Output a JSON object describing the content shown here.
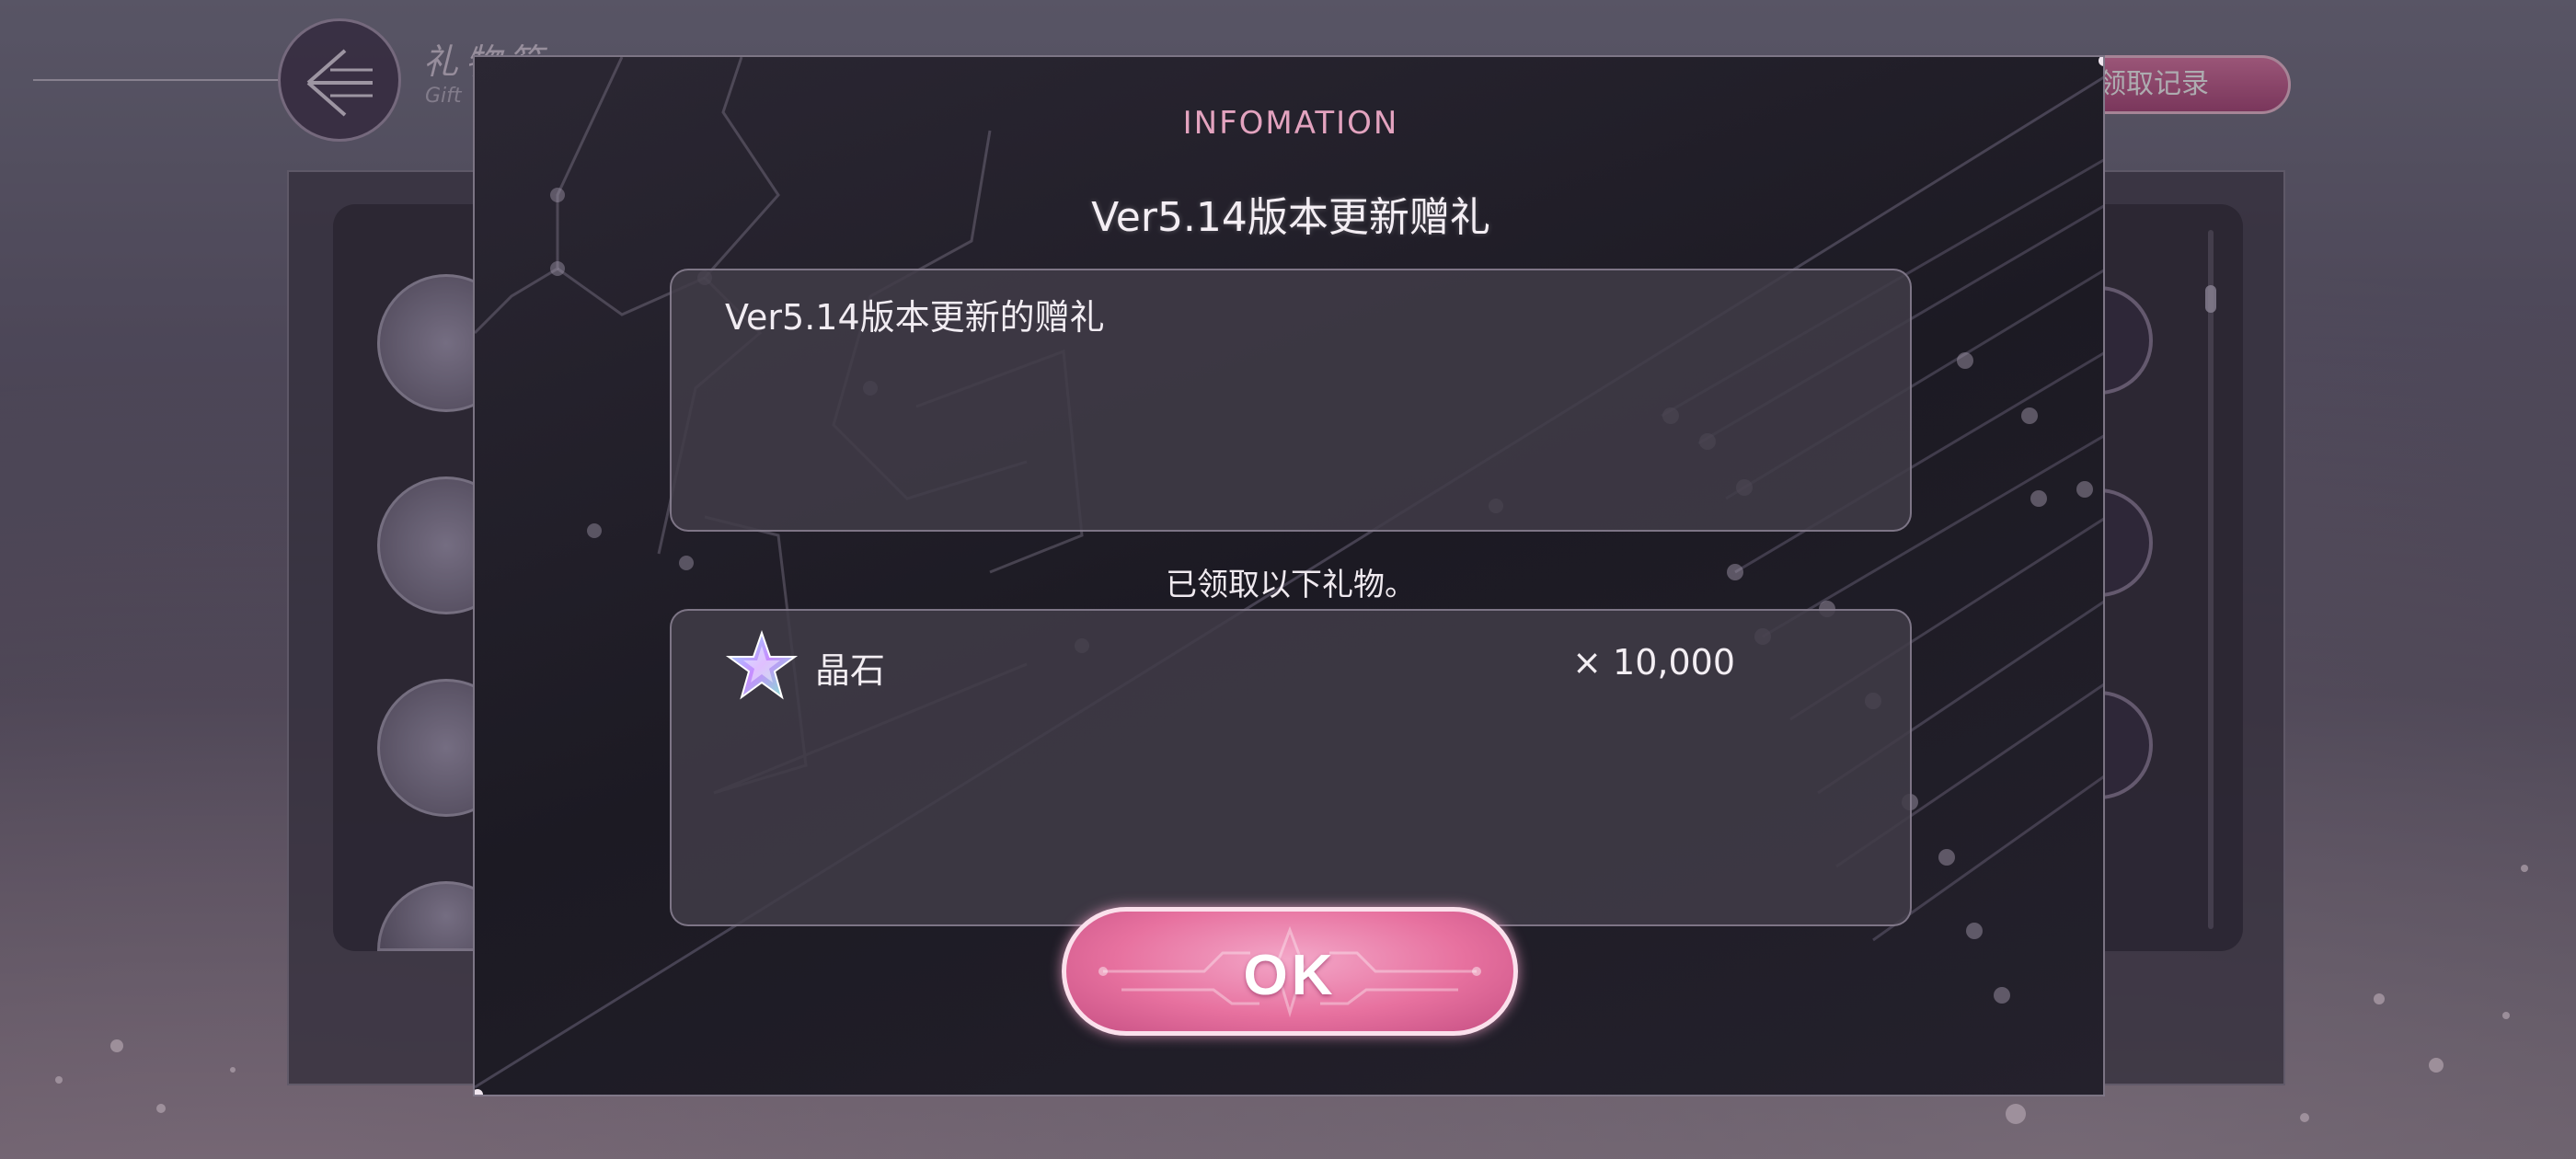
{
  "background": {
    "page_title": "礼物箱",
    "page_subtitle": "Gift",
    "history_button_label": "领取记录"
  },
  "modal": {
    "heading": "INFOMATION",
    "title": "Ver5.14版本更新赠礼",
    "description": "Ver5.14版本更新的赠礼",
    "received_label": "已领取以下礼物。",
    "rewards": [
      {
        "name": "晶石",
        "quantity": "× 10,000",
        "icon": "star-crystal-icon"
      }
    ],
    "ok_label": "OK"
  },
  "colors": {
    "accent_pink": "#e7719f",
    "heading_pink": "#e3a3bf",
    "modal_bg": "#1c1a23"
  }
}
